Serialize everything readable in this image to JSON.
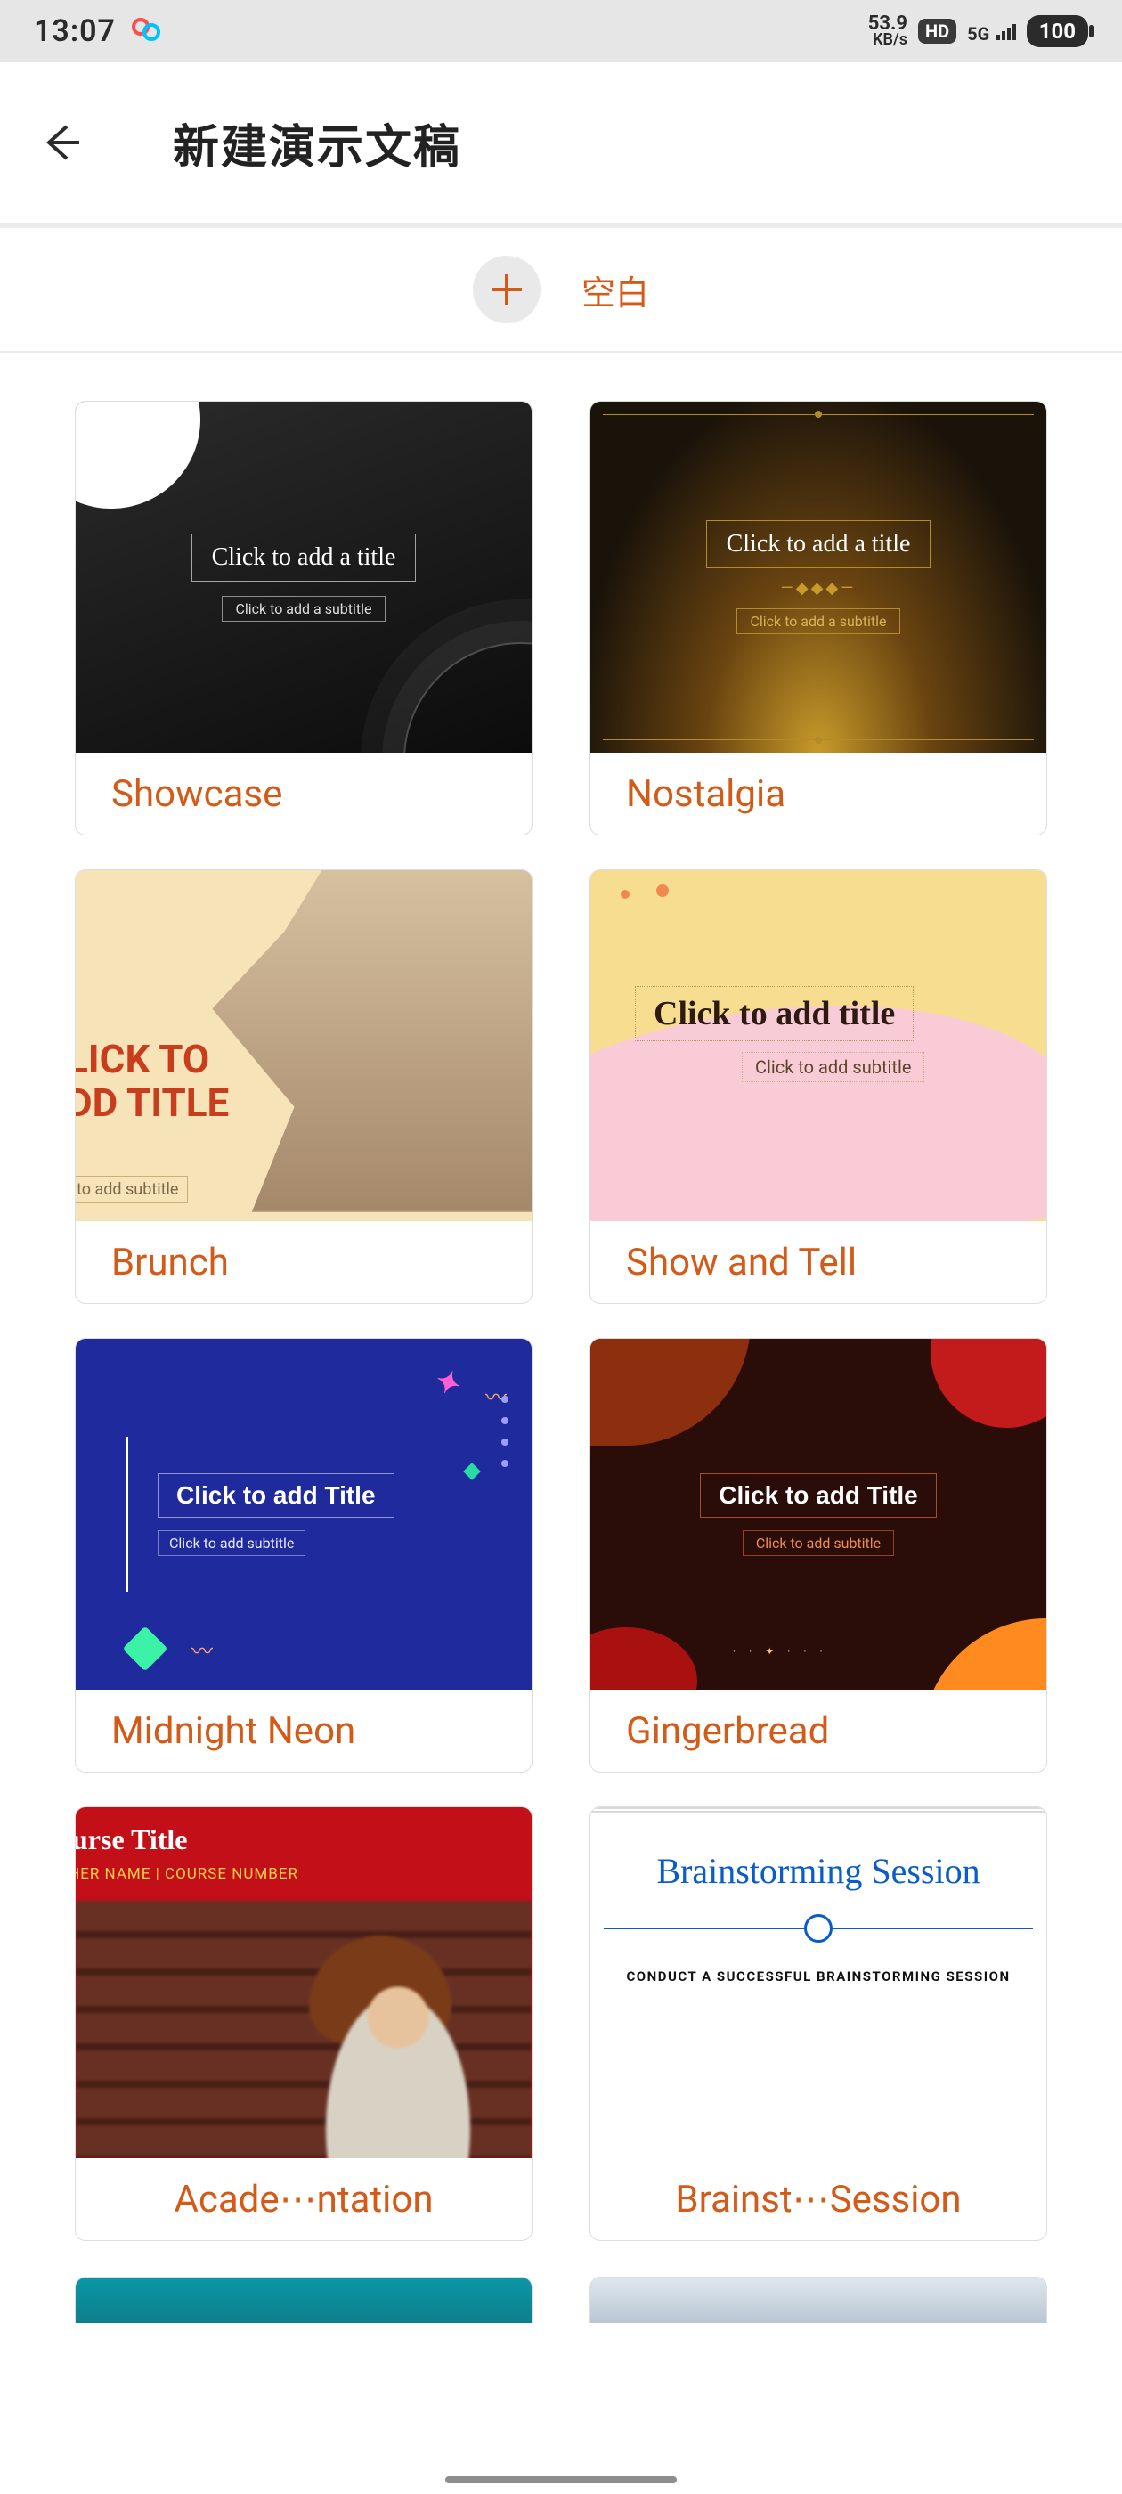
{
  "status": {
    "time": "13:07",
    "net_speed_top": "53.9",
    "net_speed_bottom": "KB/s",
    "hd_badge": "HD",
    "net_type": "5G",
    "battery": "100"
  },
  "header": {
    "title": "新建演示文稿"
  },
  "blank": {
    "label": "空白"
  },
  "templates": [
    {
      "name": "Showcase",
      "thumb": {
        "title": "Click to add a title",
        "subtitle": "Click to add a subtitle"
      }
    },
    {
      "name": "Nostalgia",
      "thumb": {
        "title": "Click to add a title",
        "subtitle": "Click to add a subtitle",
        "ornament": "—◆◆◆—"
      }
    },
    {
      "name": "Brunch",
      "thumb": {
        "title_l1": "LICK TO",
        "title_l2": "DD TITLE",
        "subtitle": "to add subtitle"
      }
    },
    {
      "name": "Show and Tell",
      "thumb": {
        "title": "Click to add title",
        "subtitle": "Click to add subtitle"
      }
    },
    {
      "name": "Midnight Neon",
      "thumb": {
        "title": "Click to add Title",
        "subtitle": "Click to add subtitle"
      }
    },
    {
      "name": "Gingerbread",
      "thumb": {
        "title": "Click to add Title",
        "subtitle": "Click to add subtitle"
      }
    },
    {
      "name": "Acade⋯ntation",
      "label_align": "center",
      "thumb": {
        "course_title": "ourse Title",
        "meta": "CHER NAME  |  COURSE NUMBER"
      }
    },
    {
      "name": "Brainst⋯Session",
      "label_align": "center",
      "thumb": {
        "title": "Brainstorming Session",
        "subtitle": "CONDUCT A SUCCESSFUL BRAINSTORMING SESSION"
      }
    }
  ]
}
